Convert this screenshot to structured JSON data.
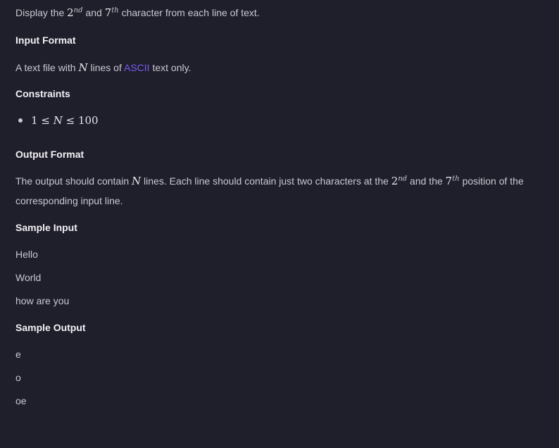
{
  "intro": {
    "t1": "Display the ",
    "n1": "2",
    "s1": "nd",
    "t2": " and ",
    "n2": "7",
    "s2": "th",
    "t3": " character from each line of text."
  },
  "input_format": {
    "heading": "Input Format",
    "t1": "A text file with ",
    "var": "N",
    "t2": " lines of ",
    "link": "ASCII",
    "t3": " text only."
  },
  "constraints": {
    "heading": "Constraints",
    "items": [
      {
        "expr": "1 ≤ N ≤ 100",
        "a": "1",
        "le1": "≤",
        "var": "N",
        "le2": "≤",
        "b": "100"
      }
    ]
  },
  "output_format": {
    "heading": "Output Format",
    "t1": "The output should contain ",
    "var": "N",
    "t2": " lines. Each line should contain just two characters at the ",
    "n1": "2",
    "s1": "nd",
    "t3": " and the ",
    "n2": "7",
    "s2": "th",
    "t4": " position of the",
    "line2": "corresponding input line."
  },
  "sample_input": {
    "heading": "Sample Input",
    "lines": [
      "Hello",
      "World",
      "how are you"
    ]
  },
  "sample_output": {
    "heading": "Sample Output",
    "lines": [
      "e",
      "o",
      "oe"
    ]
  },
  "colors": {
    "background": "#1f1e2b",
    "text": "#c9c9d1",
    "heading": "#f2f2f5",
    "link": "#7a5cf0"
  }
}
